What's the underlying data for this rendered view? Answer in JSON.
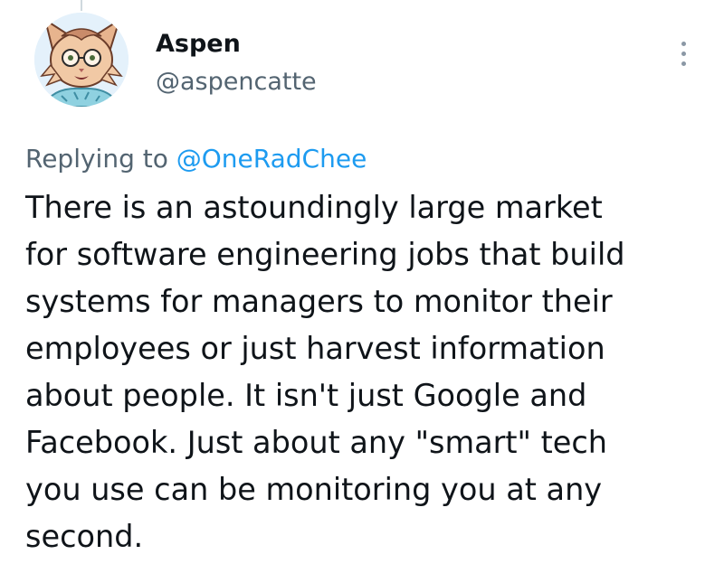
{
  "author": {
    "name": "Aspen",
    "handle": "@aspencatte",
    "avatar_icon": "lynx-avatar-icon"
  },
  "more_icon": "more-options-icon",
  "reply_context": {
    "prefix": "Replying to",
    "mention": "@OneRadChee"
  },
  "tweet": {
    "lines": [
      "There is an astoundingly large market",
      "for software engineering jobs that build",
      "systems for managers to monitor their",
      "employees or just harvest information",
      "about people. It isn't just Google and",
      "Facebook. Just about any \"smart\" tech",
      "you use can be monitoring you at any",
      "second."
    ]
  },
  "colors": {
    "text": "#0f1419",
    "secondary": "#536471",
    "link": "#1d9bf0"
  }
}
